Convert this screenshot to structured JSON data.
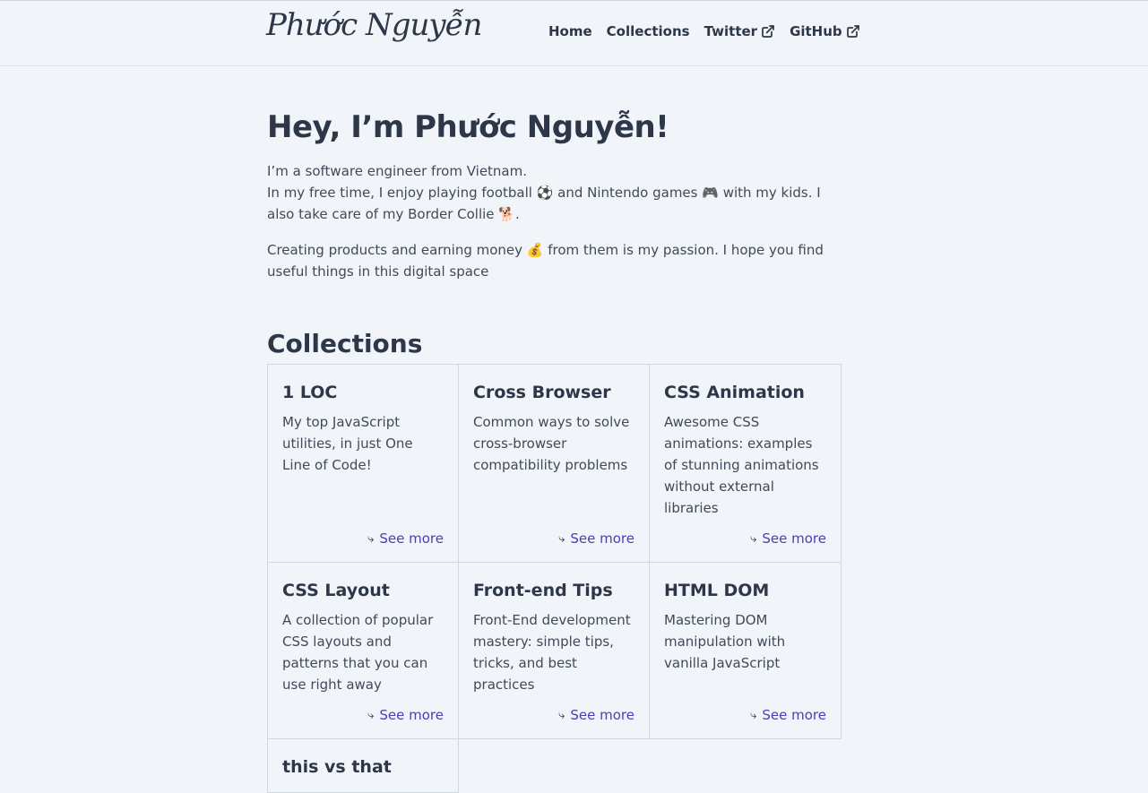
{
  "header": {
    "logo": "Phước Nguyễn",
    "nav": [
      {
        "label": "Home"
      },
      {
        "label": "Collections"
      },
      {
        "label": "Twitter",
        "icon": "external-link-icon"
      },
      {
        "label": "GitHub",
        "icon": "external-link-icon"
      }
    ]
  },
  "hero": {
    "title": "Hey, I’m Phước Nguyễn!",
    "line1": "I’m a software engineer from Vietnam.",
    "line2": "In my free time, I enjoy playing football ⚽ and Nintendo games 🎮 with my kids. I also take care of my Border Collie 🐕.",
    "line3": "Creating products and earning money 💰 from them is my passion. I hope you find useful things in this digital space"
  },
  "collections": {
    "heading": "Collections",
    "see_more_label": "See more",
    "see_more_arrow": "⤷",
    "items": [
      {
        "title": "1 LOC",
        "desc": "My top JavaScript utilities, in just One Line of Code!"
      },
      {
        "title": "Cross Browser",
        "desc": "Common ways to solve cross-browser compatibility problems"
      },
      {
        "title": "CSS Animation",
        "desc": "Awesome CSS animations: examples of stunning animations without external libraries"
      },
      {
        "title": "CSS Layout",
        "desc": "A collection of popular CSS layouts and patterns that you can use right away"
      },
      {
        "title": "Front-end Tips",
        "desc": "Front-End development mastery: simple tips, tricks, and best practices"
      },
      {
        "title": "HTML DOM",
        "desc": "Mastering DOM manipulation with vanilla JavaScript"
      },
      {
        "title": "this vs that",
        "desc": ""
      }
    ]
  },
  "colors": {
    "background": "#f1f4f8",
    "text": "#2d3748",
    "link": "#4b3db7",
    "border": "#d2d8e0"
  }
}
